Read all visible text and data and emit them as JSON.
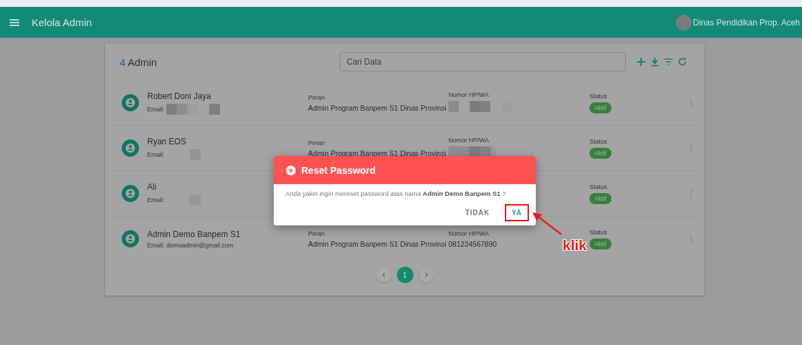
{
  "header": {
    "title": "Kelola Admin",
    "account": "Dinas Pendidikan Prop. Aceh"
  },
  "card": {
    "count": "4",
    "count_label": "Admin",
    "search": {
      "placeholder": "Cari Data"
    },
    "rows": [
      {
        "name": "Robert Doni Jaya",
        "email_label": "Email:",
        "email_redacted": true,
        "role_label": "Peran",
        "role": "Admin Program Banpem S1 Dinas Provinsi",
        "phone_label": "Nomor HP/WA",
        "phone_redacted": true,
        "status_label": "Status",
        "status": "Aktif"
      },
      {
        "name": "Ryan EOS",
        "email_label": "Email:",
        "email_redacted": true,
        "role_label": "Peran",
        "role": "Admin Program Banpem S1 Dinas Provinsi",
        "phone_label": "Nomor HP/WA",
        "phone_redacted": true,
        "status_label": "Status",
        "status": "Aktif"
      },
      {
        "name": "Ali",
        "email_label": "Email:",
        "email_redacted": true,
        "status_label": "Status",
        "status": "Aktif"
      },
      {
        "name": "Admin Demo Banpem S1",
        "email_label": "Email:",
        "email": "demoadmin@gmail.com",
        "role_label": "Peran",
        "role": "Admin Program Banpem S1 Dinas Provinsi",
        "phone_label": "Nomor HP/WA",
        "phone": "081234567890",
        "status_label": "Status",
        "status": "Aktif"
      }
    ],
    "pages": [
      {
        "label": "1",
        "selected": true
      }
    ]
  },
  "dialog": {
    "title": "Reset Password",
    "message": "Anda yakin ingin mereset password atas nama **Admin Demo Banpem S1** ?",
    "buttons": [
      {
        "label": "TIDAK",
        "highlighted": false
      },
      {
        "label": "YA",
        "highlighted": true
      }
    ]
  },
  "annotation": {
    "text": "klik"
  }
}
